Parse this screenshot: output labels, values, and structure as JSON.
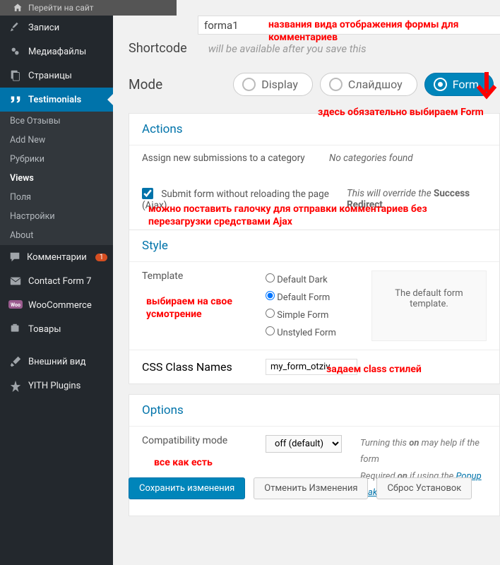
{
  "topbar": {
    "label": "Перейти на сайт"
  },
  "sidebar": {
    "items": [
      {
        "icon": "pin",
        "label": "Записи"
      },
      {
        "icon": "media",
        "label": "Медиафайлы"
      },
      {
        "icon": "pages",
        "label": "Страницы"
      }
    ],
    "active": {
      "icon": "quote",
      "label": "Testimonials"
    },
    "sub": [
      {
        "label": "Все Отзывы"
      },
      {
        "label": "Add New"
      },
      {
        "label": "Рубрики"
      },
      {
        "label": "Views",
        "current": true
      },
      {
        "label": "Поля"
      },
      {
        "label": "Настройки"
      },
      {
        "label": "About"
      }
    ],
    "items2": [
      {
        "icon": "comment",
        "label": "Комментарии",
        "badge": "1"
      },
      {
        "icon": "mail",
        "label": "Contact Form 7"
      },
      {
        "icon": "woo",
        "label": "WooCommerce"
      },
      {
        "icon": "cart",
        "label": "Товары"
      },
      {
        "icon": "brush",
        "label": "Внешний вид"
      },
      {
        "icon": "yith",
        "label": "YITH Plugins"
      }
    ]
  },
  "title_input": "forma1",
  "shortcode": {
    "label": "Shortcode",
    "hint": "will be available after you save this"
  },
  "mode": {
    "label": "Mode",
    "options": [
      "Display",
      "Слайдшоу",
      "Form"
    ],
    "selected": 2
  },
  "actions": {
    "title": "Actions",
    "assign_label": "Assign new submissions to a category",
    "assign_value": "No categories found",
    "ajax_label": "Submit form without reloading the page (Ajax)",
    "ajax_checked": true,
    "ajax_hint": "This will override the ",
    "ajax_hint_em": "Success Redirect"
  },
  "style": {
    "title": "Style",
    "template_label": "Template",
    "template_opts": [
      "Default Dark",
      "Default Form",
      "Simple Form",
      "Unstyled Form"
    ],
    "template_selected": 1,
    "template_desc": "The default form template.",
    "css_label": "CSS Class Names",
    "css_value": "my_form_otziv"
  },
  "options": {
    "title": "Options",
    "compat_label": "Compatibility mode",
    "compat_value": "off (default)",
    "compat_hint1_a": "Turning this ",
    "compat_hint1_b": "on",
    "compat_hint1_c": " may help if the form",
    "compat_hint2_a": "Required ",
    "compat_hint2_b": "on",
    "compat_hint2_c": " if using the ",
    "compat_link": "Popup Make"
  },
  "buttons": {
    "save": "Сохранить изменения",
    "cancel": "Отменить Изменения",
    "reset": "Сброс Установок"
  },
  "annotations": {
    "a1": "названия вида отображения формы для комментариев",
    "a2": "здесь обязательно выбираем Form",
    "a3": "можно поставить галочку для отправки комментариев без перезагрузки средствами Ajax",
    "a4": "выбираем на свое усмотрение",
    "a5": "задаем class  стилей",
    "a6": "все как есть"
  }
}
